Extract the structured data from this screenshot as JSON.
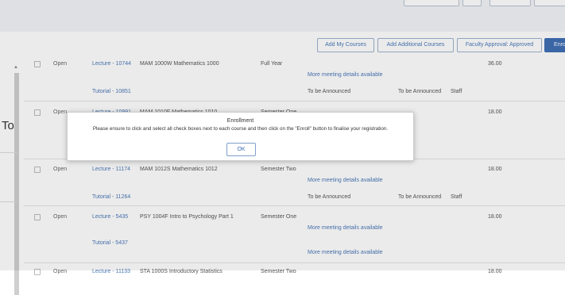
{
  "left_partial_text": "To",
  "action_buttons": {
    "add_my_courses": "Add My Courses",
    "add_additional": "Add Additional Courses",
    "faculty_approval": "Faculty Approval: Approved",
    "enroll": "Enroll"
  },
  "rows": [
    {
      "status": "Open",
      "lecture": "Lecture - 10744",
      "title": "MAM 1000W Mathematics 1000",
      "term": "Full Year",
      "meeting": "More meeting details available",
      "credits": "36.00",
      "tutorial": "Tutorial - 10851",
      "tut_col1": "To be Announced",
      "tut_col2": "To be Announced",
      "tut_col3": "Staff"
    },
    {
      "status": "Open",
      "lecture": "Lecture - 10991",
      "title": "MAM 1010F Mathematics 1010",
      "term": "Semester One",
      "meeting": "",
      "credits": "18.00",
      "tutorial": "",
      "tut_col1": "",
      "tut_col2": "",
      "tut_col3": ""
    },
    {
      "status": "Open",
      "lecture": "Lecture - 11174",
      "title": "MAM 1012S Mathematics 1012",
      "term": "Semester Two",
      "meeting": "More meeting details available",
      "credits": "18.00",
      "tutorial": "Tutorial - 11264",
      "tut_col1": "To be Announced",
      "tut_col2": "To be Announced",
      "tut_col3": "Staff"
    },
    {
      "status": "Open",
      "lecture": "Lecture - 5435",
      "title": "PSY 1004F Intro to Psychology Part 1",
      "term": "Semester One",
      "meeting": "More meeting details available",
      "credits": "18.00",
      "tutorial": "Tutorial - 5437",
      "tut_col1": "More meeting details available",
      "tut_col2": "",
      "tut_col3": ""
    },
    {
      "status": "Open",
      "lecture": "Lecture - 11133",
      "title": "STA 1000S Introductory Statistics",
      "term": "Semester Two",
      "meeting": "",
      "credits": "18.00",
      "tutorial": "",
      "tut_col1": "",
      "tut_col2": "",
      "tut_col3": ""
    }
  ],
  "dialog": {
    "title": "Enrollment",
    "message": "Please ensure to click and select all check boxes next to each course and then click on the \"Enroll\" button to finalise your registration.",
    "ok_label": "OK"
  },
  "colors": {
    "link": "#4a78b8",
    "primary": "#3f6fb5"
  }
}
